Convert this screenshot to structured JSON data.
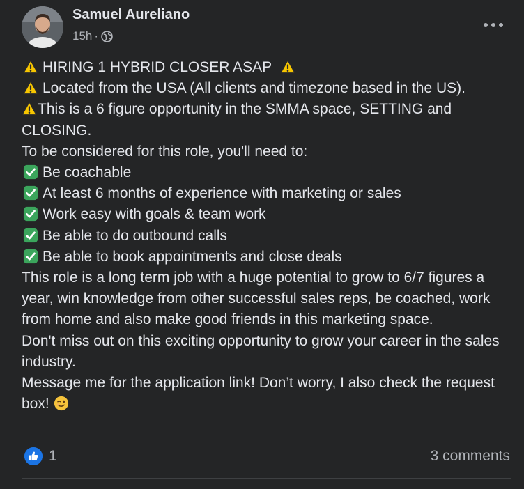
{
  "author": {
    "name": "Samuel Aureliano",
    "time": "15h",
    "separator": "·",
    "privacy_icon": "globe-icon"
  },
  "post": {
    "lines": [
      {
        "prefix_icon": "warning-emoji",
        "text": "HIRING 1 HYBRID CLOSER ASAP",
        "suffix_icon": "warning-emoji"
      },
      {
        "prefix_icon": "warning-emoji",
        "text": "Located from the USA (All clients and timezone based in the US)."
      },
      {
        "prefix_icon": "warning-emoji",
        "text": "This is a 6 figure opportunity in the SMMA space, SETTING and CLOSING."
      },
      {
        "text": "To be considered for this role, you'll need to:"
      },
      {
        "prefix_icon": "check-mark-emoji",
        "text": "Be coachable"
      },
      {
        "prefix_icon": "check-mark-emoji",
        "text": "At least 6 months of experience with marketing or sales"
      },
      {
        "prefix_icon": "check-mark-emoji",
        "text": "Work easy with goals & team work"
      },
      {
        "prefix_icon": "check-mark-emoji",
        "text": "Be able to do outbound calls"
      },
      {
        "prefix_icon": "check-mark-emoji",
        "text": "Be able to book appointments and close deals"
      },
      {
        "text": "This role is a long term job with a huge potential to grow to 6/7 figures a year, win knowledge from other successful sales reps, be coached, work from home and also make good friends in this marketing space."
      },
      {
        "text": "Don't miss out on this exciting opportunity to grow your career in the sales industry."
      },
      {
        "text": "Message me for the application link! Don’t worry, I also check the request box!",
        "suffix_icon": "winking-face-emoji"
      }
    ]
  },
  "reactions": {
    "icon": "like-icon",
    "count": "1",
    "comments": "3 comments"
  },
  "colors": {
    "background": "#242526",
    "text_primary": "#e4e6eb",
    "text_secondary": "#b0b3b8",
    "like_blue": "#1b74e4",
    "check_green": "#3ba55c",
    "warning_yellow": "#f7c600"
  }
}
